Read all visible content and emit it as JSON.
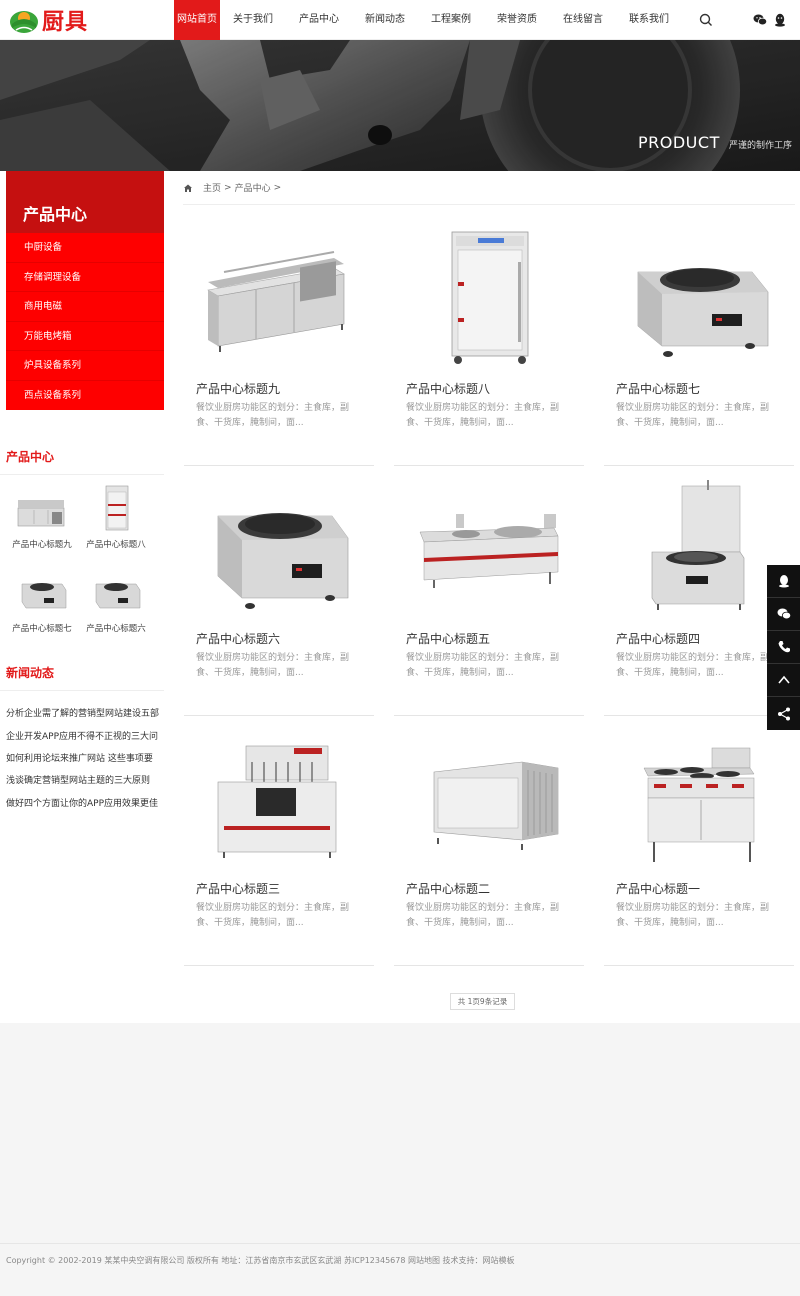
{
  "header": {
    "logo_text": "厨具",
    "nav": [
      {
        "label": "网站首页",
        "active": true
      },
      {
        "label": "关于我们"
      },
      {
        "label": "产品中心"
      },
      {
        "label": "新闻动态"
      },
      {
        "label": "工程案例"
      },
      {
        "label": "荣誉资质"
      },
      {
        "label": "在线留言"
      },
      {
        "label": "联系我们"
      }
    ],
    "icons": [
      "search-icon",
      "wechat-icon",
      "qq-icon"
    ]
  },
  "banner": {
    "title": "PRODUCT",
    "subtitle": "严谨的制作工序"
  },
  "sidebar": {
    "category_title": "产品中心",
    "categories": [
      "中厨设备",
      "存储调理设备",
      "商用电磁",
      "万能电烤箱",
      "炉具设备系列",
      "西点设备系列"
    ],
    "products_title": "产品中心",
    "mini_products": [
      "产品中心标题九",
      "产品中心标题八",
      "产品中心标题七",
      "产品中心标题六"
    ],
    "news_title": "新闻动态",
    "news": [
      "分析企业需了解的营销型网站建设五部",
      "企业开发APP应用不得不正视的三大问",
      "如何利用论坛来推广网站 这些事项要",
      "浅谈确定营销型网站主题的三大原则",
      "做好四个方面让你的APP应用效果更佳"
    ]
  },
  "breadcrumb": {
    "home": "主页",
    "sep": ">",
    "current": "产品中心",
    "tail": ">"
  },
  "products": [
    {
      "title": "产品中心标题九",
      "desc": "餐饮业厨房功能区的划分：主食库，副食、干货库，腌制间，面...",
      "image": "refrigerated-counter"
    },
    {
      "title": "产品中心标题八",
      "desc": "餐饮业厨房功能区的划分：主食库，副食、干货库，腌制间，面...",
      "image": "steamer-cabinet"
    },
    {
      "title": "产品中心标题七",
      "desc": "餐饮业厨房功能区的划分：主食库，副食、干货库，腌制间，面...",
      "image": "induction-wok"
    },
    {
      "title": "产品中心标题六",
      "desc": "餐饮业厨房功能区的划分：主食库，副食、干货库，腌制间，面...",
      "image": "induction-wok"
    },
    {
      "title": "产品中心标题五",
      "desc": "餐饮业厨房功能区的划分：主食库，副食、干货库，腌制间，面...",
      "image": "double-wok-range"
    },
    {
      "title": "产品中心标题四",
      "desc": "餐饮业厨房功能区的划分：主食库，副食、干货库，腌制间，面...",
      "image": "soup-stove"
    },
    {
      "title": "产品中心标题三",
      "desc": "餐饮业厨房功能区的划分：主食库，副食、干货库，腌制间，面...",
      "image": "noodle-cooker"
    },
    {
      "title": "产品中心标题二",
      "desc": "餐饮业厨房功能区的划分：主食库，副食、干货库，腌制间，面...",
      "image": "warming-cabinet"
    },
    {
      "title": "产品中心标题一",
      "desc": "餐饮业厨房功能区的划分：主食库，副食、干货库，腌制间，面...",
      "image": "four-burner-range"
    }
  ],
  "pager": {
    "text": "共 1页9条记录"
  },
  "footer": {
    "text": "Copyright © 2002-2019 某某中央空调有限公司 版权所有   地址：江苏省南京市玄武区玄武湖   苏ICP12345678   网站地图   技术支持：网站模板"
  },
  "float_bar": [
    "qq-icon",
    "wechat-icon",
    "phone-icon",
    "back-to-top-icon",
    "share-icon"
  ],
  "colors": {
    "accent": "#e21a1a",
    "category_head": "#c51010",
    "category_list": "#fe0000"
  }
}
